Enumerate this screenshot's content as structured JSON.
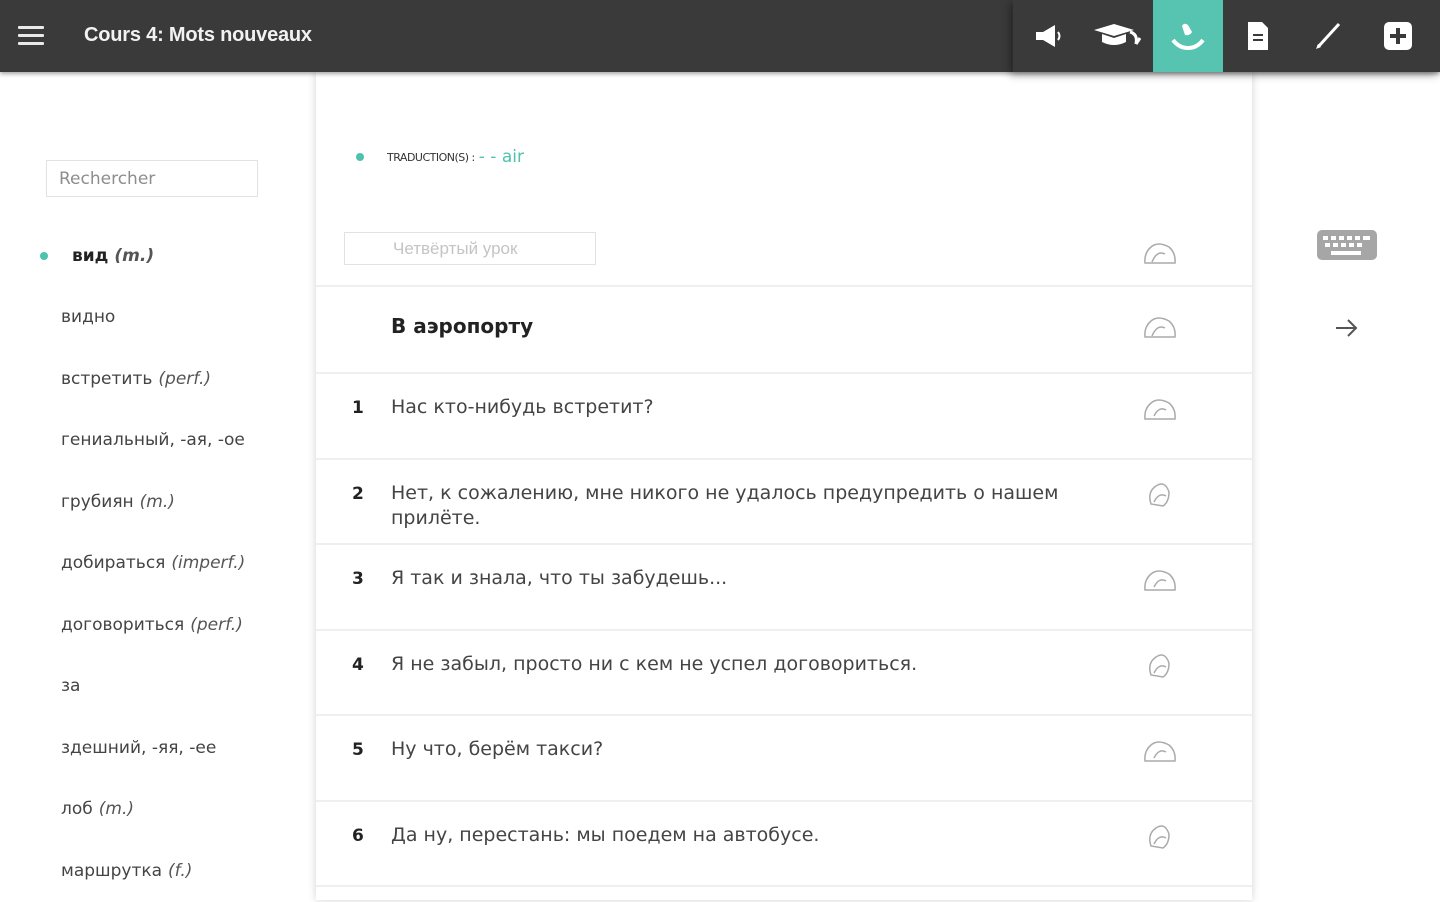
{
  "header": {
    "title": "Cours 4: Mots nouveaux",
    "menu_icon": "hamburger-menu-icon",
    "tools": [
      {
        "name": "megaphone-icon",
        "active": false
      },
      {
        "name": "graduation-cap-icon",
        "active": false
      },
      {
        "name": "hand-icon",
        "active": true
      },
      {
        "name": "document-icon",
        "active": false
      },
      {
        "name": "pencil-icon",
        "active": false
      },
      {
        "name": "add-icon",
        "active": false
      }
    ],
    "active_color": "#56c4b0"
  },
  "sidebar": {
    "search_placeholder": "Rechercher",
    "items": [
      {
        "word": "вид",
        "gram": "(m.)",
        "selected": true
      },
      {
        "word": "видно",
        "gram": ""
      },
      {
        "word": "встретить",
        "gram": "(perf.)"
      },
      {
        "word": "гениальный, -ая, -ое",
        "gram": ""
      },
      {
        "word": "грубиян",
        "gram": "(m.)"
      },
      {
        "word": "добираться",
        "gram": "(imperf.)"
      },
      {
        "word": "договориться",
        "gram": "(perf.)"
      },
      {
        "word": "за",
        "gram": ""
      },
      {
        "word": "здешний, -яя, -ее",
        "gram": ""
      },
      {
        "word": "лоб",
        "gram": "(m.)"
      },
      {
        "word": "маршрутка",
        "gram": "(f.)"
      }
    ]
  },
  "main": {
    "translation_label": "TRADUCTION(S) :",
    "translation_value": "- - air",
    "lesson_placeholder": "Четвёртый урок",
    "heading": "В аэропорту",
    "lines": [
      {
        "num": "1",
        "text": "Нас кто-нибудь встретит?"
      },
      {
        "num": "2",
        "text": "Нет, к сожалению, мне никого не удалось предупредить о нашем прилёте."
      },
      {
        "num": "3",
        "text": "Я так и знала, что ты забудешь..."
      },
      {
        "num": "4",
        "text": "Я не забыл, просто ни с кем не успел договориться."
      },
      {
        "num": "5",
        "text": "Ну что, берём такси?"
      },
      {
        "num": "6",
        "text": "Да ну, перестань: мы поедем на автобусе."
      }
    ],
    "accent_color": "#4dc2ad"
  },
  "right": {
    "keyboard_icon": "keyboard-icon",
    "arrow_icon": "arrow-right-icon"
  }
}
